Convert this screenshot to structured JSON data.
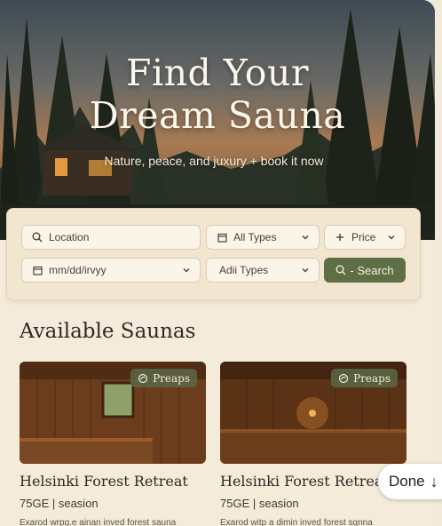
{
  "hero": {
    "title_line1": "Find Your",
    "title_line2": "Dream Sauna",
    "subtitle": "Nature, peace, and juxury + book it now"
  },
  "search": {
    "location_placeholder": "Location",
    "types_label": "All Types",
    "price_label": "Price",
    "date_placeholder": "mm/dd/irvyy",
    "types2_label": "Adii Types",
    "search_label": "- Search"
  },
  "listings": {
    "title": "Available Saunas",
    "cards": [
      {
        "badge": "Preaps",
        "title": "Helsinki Forest Retreat",
        "meta": "75GE | seasion",
        "desc": "Exarod wrpg.e ainan inved forest sauna"
      },
      {
        "badge": "Preaps",
        "title": "Helsinki Forest Retreat",
        "meta": "75GE | seasion",
        "desc": "Exarod witp a dimin inved forest sqnna"
      }
    ]
  },
  "done": {
    "label": "Done",
    "arrow": "↓"
  },
  "colors": {
    "accent": "#5e6f45",
    "background": "#f5ebdb",
    "panel": "#f3e6d0"
  }
}
